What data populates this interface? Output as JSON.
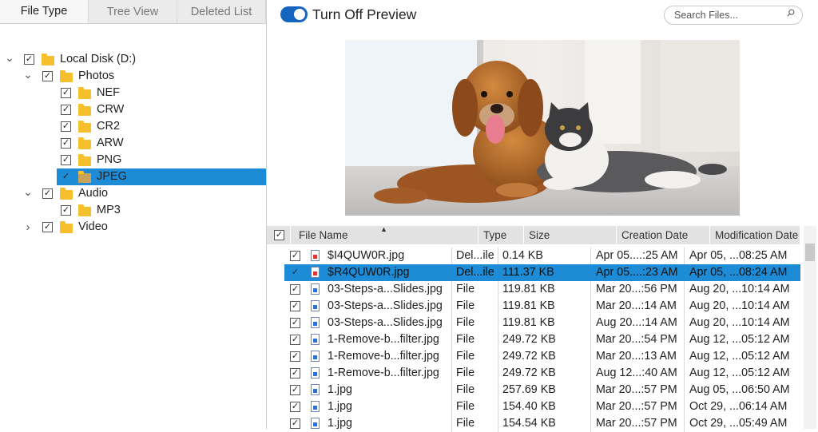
{
  "tabs": [
    "File Type",
    "Tree View",
    "Deleted List"
  ],
  "tree": [
    {
      "label": "Local Disk (D:)",
      "level": 0,
      "expand": "v",
      "checked": true
    },
    {
      "label": "Photos",
      "level": 1,
      "expand": "v",
      "checked": true
    },
    {
      "label": "NEF",
      "level": 2,
      "expand": "",
      "checked": true
    },
    {
      "label": "CRW",
      "level": 2,
      "expand": "",
      "checked": true
    },
    {
      "label": "CR2",
      "level": 2,
      "expand": "",
      "checked": true
    },
    {
      "label": "ARW",
      "level": 2,
      "expand": "",
      "checked": true
    },
    {
      "label": "PNG",
      "level": 2,
      "expand": "",
      "checked": true
    },
    {
      "label": "JPEG",
      "level": 2,
      "expand": "",
      "checked": true,
      "selected": true
    },
    {
      "label": "Audio",
      "level": 1,
      "expand": "v",
      "checked": true
    },
    {
      "label": "MP3",
      "level": 2,
      "expand": "",
      "checked": true
    },
    {
      "label": "Video",
      "level": 1,
      "expand": ">",
      "checked": true
    }
  ],
  "preview": {
    "toggle_label": "Turn Off Preview",
    "toggle_on": true
  },
  "search": {
    "placeholder": "Search Files..."
  },
  "columns": [
    "File Name",
    "Type",
    "Size",
    "Creation Date",
    "Modification Date"
  ],
  "files": [
    {
      "name": "$I4QUW0R.jpg",
      "type": "Del...ile",
      "size": "0.14 KB",
      "created": "Apr 05....:25 AM",
      "modified": "Apr 05, ...08:25 AM",
      "deleted": true
    },
    {
      "name": "$R4QUW0R.jpg",
      "type": "Del...ile",
      "size": "111.37 KB",
      "created": "Apr 05....:23 AM",
      "modified": "Apr 05, ...08:24 AM",
      "deleted": true,
      "selected": true
    },
    {
      "name": "03-Steps-a...Slides.jpg",
      "type": "File",
      "size": "119.81 KB",
      "created": "Mar 20...:56 PM",
      "modified": "Aug 20, ...10:14 AM"
    },
    {
      "name": "03-Steps-a...Slides.jpg",
      "type": "File",
      "size": "119.81 KB",
      "created": "Mar 20...:14 AM",
      "modified": "Aug 20, ...10:14 AM"
    },
    {
      "name": "03-Steps-a...Slides.jpg",
      "type": "File",
      "size": "119.81 KB",
      "created": "Aug 20...:14 AM",
      "modified": "Aug 20, ...10:14 AM"
    },
    {
      "name": "1-Remove-b...filter.jpg",
      "type": "File",
      "size": "249.72 KB",
      "created": "Mar 20...:54 PM",
      "modified": "Aug 12, ...05:12 AM"
    },
    {
      "name": "1-Remove-b...filter.jpg",
      "type": "File",
      "size": "249.72 KB",
      "created": "Mar 20...:13 AM",
      "modified": "Aug 12, ...05:12 AM"
    },
    {
      "name": "1-Remove-b...filter.jpg",
      "type": "File",
      "size": "249.72 KB",
      "created": "Aug 12...:40 AM",
      "modified": "Aug 12, ...05:12 AM"
    },
    {
      "name": "1.jpg",
      "type": "File",
      "size": "257.69 KB",
      "created": "Mar 20...:57 PM",
      "modified": "Aug 05, ...06:50 AM"
    },
    {
      "name": "1.jpg",
      "type": "File",
      "size": "154.40 KB",
      "created": "Mar 20...:57 PM",
      "modified": "Oct 29, ...06:14 AM"
    },
    {
      "name": "1.jpg",
      "type": "File",
      "size": "154.54 KB",
      "created": "Mar 20...:57 PM",
      "modified": "Oct 29, ...05:49 AM"
    }
  ],
  "colors": {
    "accent": "#1e8bd7",
    "toggle": "#1565c0",
    "folder": "#f6c02d"
  }
}
